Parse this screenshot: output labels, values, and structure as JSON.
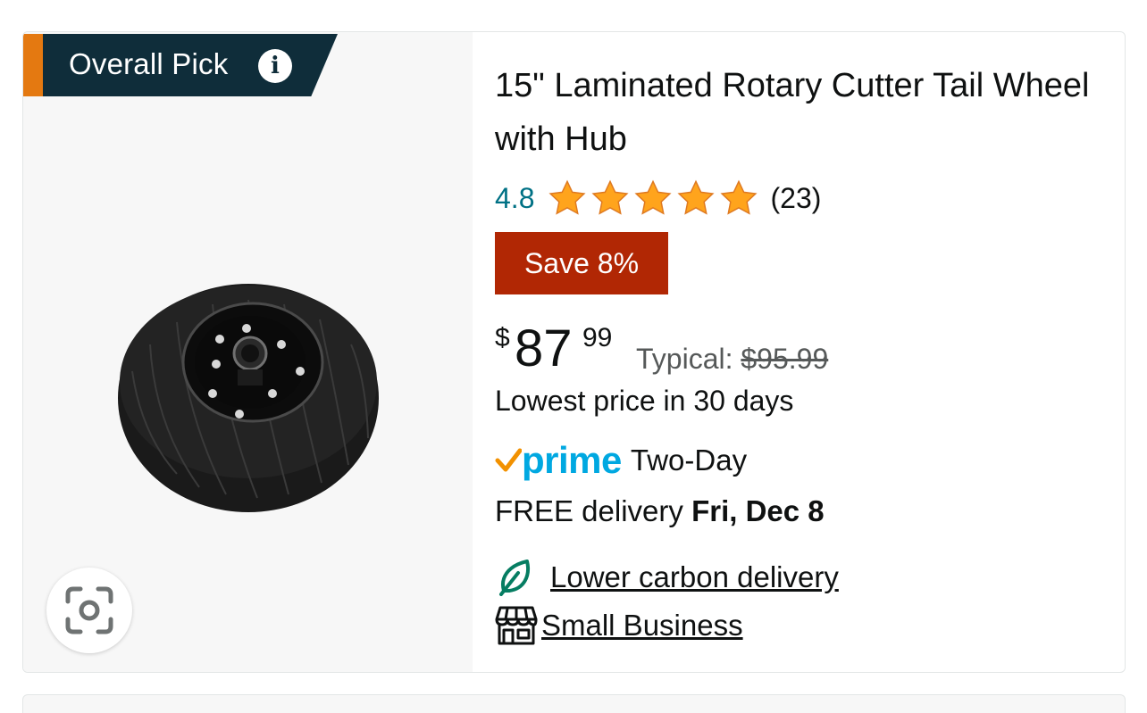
{
  "badge": {
    "label": "Overall Pick",
    "info_icon": "info-icon"
  },
  "product": {
    "image_icon": "tail-wheel-image",
    "title": "15\" Laminated Rotary Cutter Tail Wheel with Hub",
    "rating": "4.8",
    "stars": 4.8,
    "review_count": "(23)",
    "save_label": "Save 8%",
    "price": {
      "symbol": "$",
      "whole": "87",
      "fraction": "99"
    },
    "typical_label": "Typical:",
    "typical_price": "$95.99",
    "lowest_price_text": "Lowest price in 30 days",
    "prime_logo_text": "prime",
    "prime_label": "Two-Day",
    "delivery_prefix": "FREE delivery",
    "delivery_date": "Fri, Dec 8",
    "carbon_label": "Lower carbon delivery",
    "small_business_label": "Small Business"
  },
  "colors": {
    "badge_background": "#0f2d3a",
    "badge_stripe": "#e47911",
    "save_background": "#b12704",
    "star": "#ffa41c",
    "rating_text": "#007185",
    "prime_blue": "#00a8e1",
    "carbon_green": "#067d62"
  }
}
